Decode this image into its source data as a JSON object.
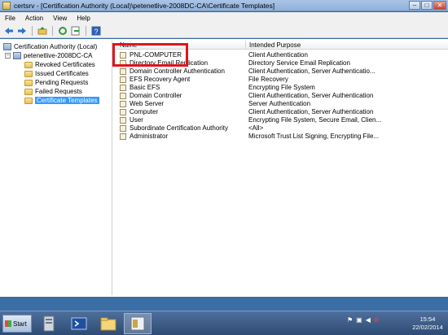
{
  "window": {
    "title": "certsrv - [Certification Authority (Local)\\petenetlive-2008DC-CA\\Certificate Templates]",
    "controls": [
      "minimize",
      "maximize",
      "close"
    ]
  },
  "menu": [
    "File",
    "Action",
    "View",
    "Help"
  ],
  "toolbar": [
    "back-icon",
    "forward-icon",
    "up-icon",
    "refresh-icon",
    "export-icon",
    "help-icon"
  ],
  "tree": {
    "root": "Certification Authority (Local)",
    "ca": "petenetlive-2008DC-CA",
    "items": [
      {
        "label": "Revoked Certificates"
      },
      {
        "label": "Issued Certificates"
      },
      {
        "label": "Pending Requests"
      },
      {
        "label": "Failed Requests"
      },
      {
        "label": "Certificate Templates",
        "selected": true
      }
    ]
  },
  "list": {
    "columns": [
      "Name",
      "Intended Purpose"
    ],
    "rows": [
      {
        "name": "PNL-COMPUTER",
        "purpose": "Client Authentication"
      },
      {
        "name": "Directory Email Replication",
        "purpose": "Directory Service Email Replication"
      },
      {
        "name": "Domain Controller Authentication",
        "purpose": "Client Authentication, Server Authenticatio..."
      },
      {
        "name": "EFS Recovery Agent",
        "purpose": "File Recovery"
      },
      {
        "name": "Basic EFS",
        "purpose": "Encrypting File System"
      },
      {
        "name": "Domain Controller",
        "purpose": "Client Authentication, Server Authentication"
      },
      {
        "name": "Web Server",
        "purpose": "Server Authentication"
      },
      {
        "name": "Computer",
        "purpose": "Client Authentication, Server Authentication"
      },
      {
        "name": "User",
        "purpose": "Encrypting File System, Secure Email, Clien..."
      },
      {
        "name": "Subordinate Certification Authority",
        "purpose": "<All>"
      },
      {
        "name": "Administrator",
        "purpose": "Microsoft Trust List Signing, Encrypting File..."
      }
    ]
  },
  "taskbar": {
    "start_label": "Start",
    "clock_time": "15:54",
    "clock_date": "22/02/2014"
  },
  "colors": {
    "highlight": "#e0141b",
    "selection": "#3399ff"
  }
}
